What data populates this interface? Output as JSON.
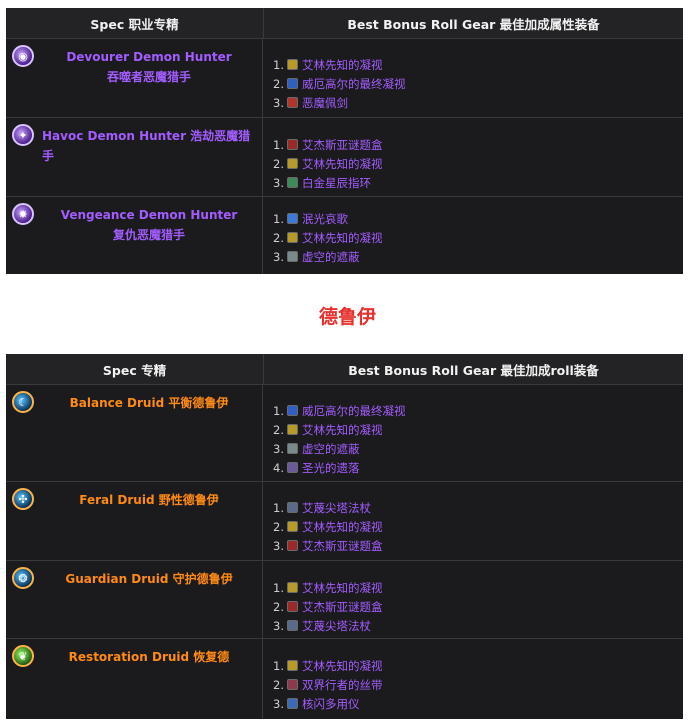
{
  "table1": {
    "header_spec": "Spec 职业专精",
    "header_gear": "Best Bonus Roll Gear 最佳加成属性装备",
    "rows": [
      {
        "spec_line1": "Devourer Demon Hunter",
        "spec_line2": "吞噬者恶魔猎手",
        "icon": "devourer-icon",
        "gear": [
          {
            "num": "1.",
            "icon": "gold-seal-icon",
            "color": "#b89a2a",
            "name": "艾林先知的凝视"
          },
          {
            "num": "2.",
            "icon": "blue-eye-icon",
            "color": "#2d5fc4",
            "name": "威厄高尔的最终凝视"
          },
          {
            "num": "3.",
            "icon": "red-blade-icon",
            "color": "#b2352c",
            "name": "恶魔佩剑"
          }
        ]
      },
      {
        "spec_line1": "Havoc Demon Hunter 浩劫恶魔猎手",
        "spec_line2": "",
        "icon": "havoc-icon",
        "gear": [
          {
            "num": "1.",
            "icon": "red-box-icon",
            "color": "#9a2a2a",
            "name": "艾杰斯亚谜题盒"
          },
          {
            "num": "2.",
            "icon": "gold-seal-icon",
            "color": "#b89a2a",
            "name": "艾林先知的凝视"
          },
          {
            "num": "3.",
            "icon": "green-ring-icon",
            "color": "#3a8a5a",
            "name": "白金星辰指环"
          }
        ]
      },
      {
        "spec_line1": "Vengeance Demon Hunter",
        "spec_line2": "复仇恶魔猎手",
        "icon": "vengeance-icon",
        "gear": [
          {
            "num": "1.",
            "icon": "blue-flame-icon",
            "color": "#3a7ad8",
            "name": "泯光哀歌"
          },
          {
            "num": "2.",
            "icon": "gold-seal-icon",
            "color": "#b89a2a",
            "name": "艾林先知的凝视"
          },
          {
            "num": "3.",
            "icon": "grey-shield-icon",
            "color": "#7a8a8a",
            "name": "虚空的遮蔽"
          }
        ]
      }
    ]
  },
  "section_title": "德鲁伊",
  "table2": {
    "header_spec": "Spec 专精",
    "header_gear": "Best Bonus Roll Gear 最佳加成roll装备",
    "rows": [
      {
        "spec_line1": "Balance Druid 平衡德鲁伊",
        "spec_line2": "",
        "icon": "moon-icon",
        "gear": [
          {
            "num": "1.",
            "icon": "blue-eye-icon",
            "color": "#2d5fc4",
            "name": "威厄高尔的最终凝视"
          },
          {
            "num": "2.",
            "icon": "gold-seal-icon",
            "color": "#b89a2a",
            "name": "艾林先知的凝视"
          },
          {
            "num": "3.",
            "icon": "grey-shield-icon",
            "color": "#7a8a8a",
            "name": "虚空的遮蔽"
          },
          {
            "num": "4.",
            "icon": "purple-relic-icon",
            "color": "#6a5a9a",
            "name": "圣光的遗落"
          }
        ]
      },
      {
        "spec_line1": "Feral Druid 野性德鲁伊",
        "spec_line2": "",
        "icon": "claw-icon",
        "gear": [
          {
            "num": "1.",
            "icon": "staff-icon",
            "color": "#5a6a8a",
            "name": "艾蔑尖塔法杖"
          },
          {
            "num": "2.",
            "icon": "gold-seal-icon",
            "color": "#b89a2a",
            "name": "艾林先知的凝视"
          },
          {
            "num": "3.",
            "icon": "red-box-icon",
            "color": "#9a2a2a",
            "name": "艾杰斯亚谜题盒"
          }
        ]
      },
      {
        "spec_line1": "Guardian Druid 守护德鲁伊",
        "spec_line2": "",
        "icon": "bear-icon",
        "gear": [
          {
            "num": "1.",
            "icon": "gold-seal-icon",
            "color": "#b89a2a",
            "name": "艾林先知的凝视"
          },
          {
            "num": "2.",
            "icon": "red-box-icon",
            "color": "#9a2a2a",
            "name": "艾杰斯亚谜题盒"
          },
          {
            "num": "3.",
            "icon": "staff-icon",
            "color": "#5a6a8a",
            "name": "艾蔑尖塔法杖"
          }
        ]
      },
      {
        "spec_line1": "Restoration Druid 恢复德",
        "spec_line2": "",
        "icon": "leaf-icon",
        "gear": [
          {
            "num": "1.",
            "icon": "gold-seal-icon",
            "color": "#b89a2a",
            "name": "艾林先知的凝视"
          },
          {
            "num": "2.",
            "icon": "ribbon-icon",
            "color": "#8a3a4a",
            "name": "双界行者的丝带"
          },
          {
            "num": "3.",
            "icon": "tool-icon",
            "color": "#3a6ab8",
            "name": "核闪多用仪"
          }
        ]
      }
    ]
  }
}
